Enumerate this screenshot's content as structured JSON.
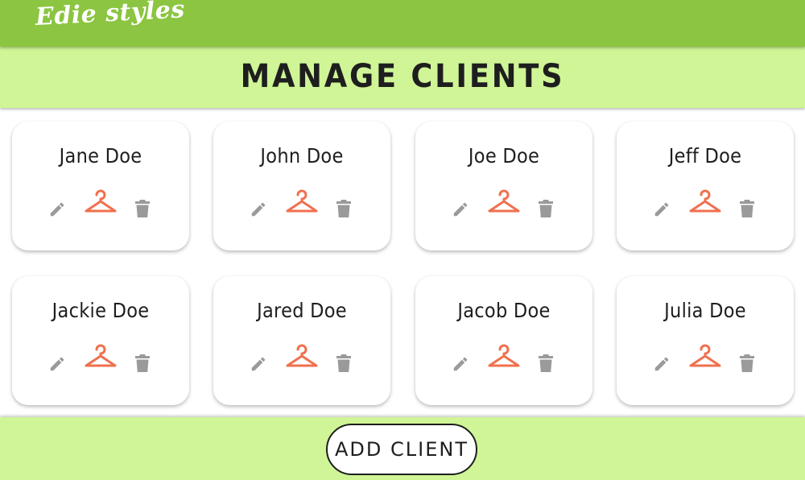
{
  "app": {
    "brand": "Edie styles"
  },
  "page": {
    "title": "MANAGE CLIENTS"
  },
  "clients": [
    {
      "name": "Jane Doe"
    },
    {
      "name": "John Doe"
    },
    {
      "name": "Joe Doe"
    },
    {
      "name": "Jeff Doe"
    },
    {
      "name": "Jackie Doe"
    },
    {
      "name": "Jared Doe"
    },
    {
      "name": "Jacob Doe"
    },
    {
      "name": "Julia Doe"
    }
  ],
  "card_actions": {
    "edit_icon": "pencil-icon",
    "wardrobe_icon": "hanger-icon",
    "delete_icon": "trash-icon"
  },
  "footer": {
    "add_label": "ADD CLIENT"
  },
  "colors": {
    "header_green": "#8bc541",
    "band_green": "#cff596",
    "hanger_orange": "#f0704e",
    "icon_gray": "#9a9a9a",
    "text_dark": "#1e1e1e"
  }
}
